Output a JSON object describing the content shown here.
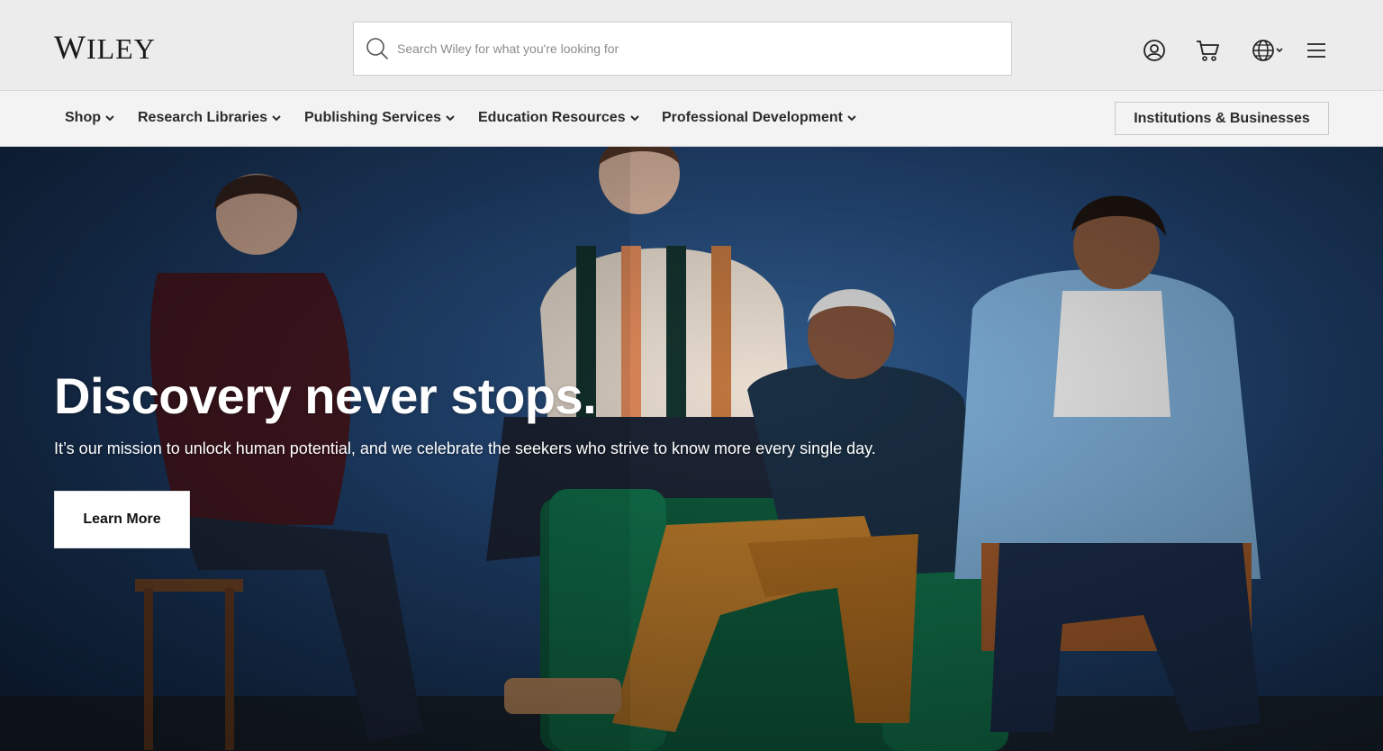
{
  "header": {
    "logo_text": "Wiley",
    "search_placeholder": "Search Wiley for what you're looking for",
    "icons": [
      "search-icon",
      "account-icon",
      "cart-icon",
      "globe-icon",
      "chevron-down-icon",
      "menu-icon"
    ]
  },
  "nav": {
    "items": [
      {
        "label": "Shop"
      },
      {
        "label": "Research Libraries"
      },
      {
        "label": "Publishing Services"
      },
      {
        "label": "Education Resources"
      },
      {
        "label": "Professional Development"
      }
    ],
    "institutions_button": "Institutions & Businesses"
  },
  "hero": {
    "title": "Discovery never stops.",
    "subtitle": "It’s our mission to unlock human potential, and we celebrate the seekers who strive to know more every single day.",
    "cta_label": "Learn More"
  },
  "colors": {
    "header_bg": "#ececec",
    "nav_bg": "#f3f3f3",
    "hero_bg": "#24497a",
    "text_dark": "#2c2c2c"
  }
}
